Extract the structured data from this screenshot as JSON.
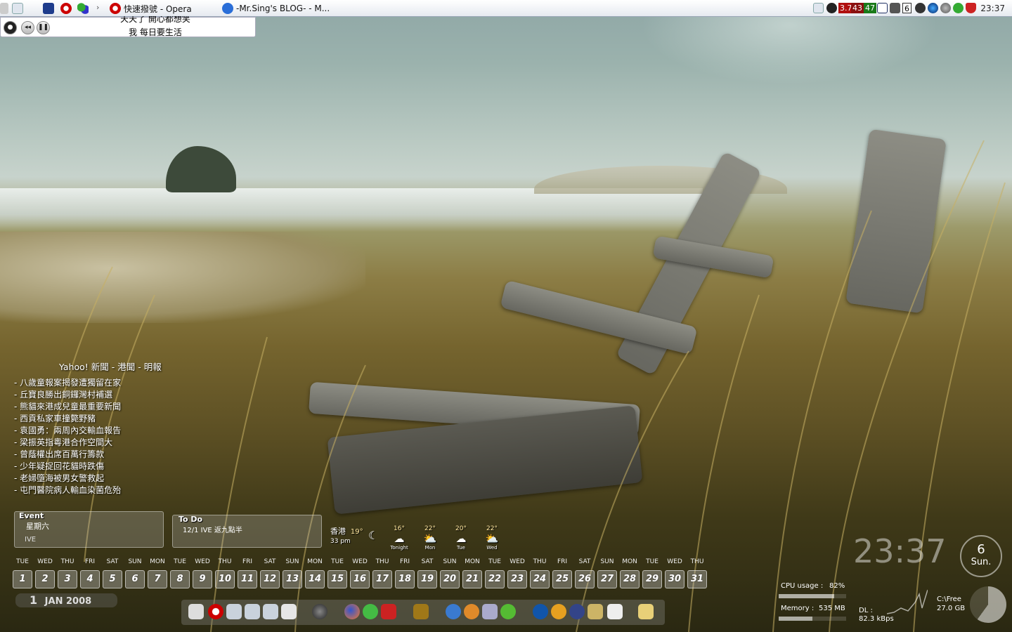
{
  "taskbar": {
    "buttons": [
      {
        "label": "快速撥號 - Opera"
      },
      {
        "label": "-Mr.Sing's BLOG- - M..."
      }
    ],
    "tray_badges": [
      {
        "value": "3.7",
        "color": "#b01010"
      },
      {
        "value": "43",
        "color": "#8a1010"
      },
      {
        "value": "47",
        "color": "#1a7a1a"
      },
      {
        "value": "6",
        "color": "#ffffff"
      }
    ],
    "clock": "23:37"
  },
  "lyrics": {
    "line1": "天天了 開心都想笑",
    "line2": "我 每日要生活"
  },
  "news": {
    "title": "Yahoo! 新聞 - 港聞 - 明報",
    "items": [
      "八歲童報案揭發遭獨留在家",
      "丘寶良勝出銅鑼灣村補選",
      "熊貓來港成兒童最重要新聞",
      "西貢私家車撞斃野豬",
      "袁國勇：兩周內交輸血報告",
      "梁振英指粵港合作空間大",
      "曾蔭權出席百萬行籌款",
      "少年疑捉回花貓時跌傷",
      "老婦墮海被男女警救起",
      "屯門醫院病人輸血染菌危殆"
    ]
  },
  "event": {
    "header": "Event",
    "day": "星期六",
    "item": "IVE"
  },
  "todo": {
    "header": "To Do",
    "item": "12/1  IVE 返九點半"
  },
  "calendar": {
    "days": [
      "TUE",
      "WED",
      "THU",
      "FRI",
      "SAT",
      "SUN",
      "MON",
      "TUE",
      "WED",
      "THU",
      "FRI",
      "SAT",
      "SUN",
      "MON",
      "TUE",
      "WED",
      "THU",
      "FRI",
      "SAT",
      "SUN",
      "MON",
      "TUE",
      "WED",
      "THU",
      "FRI",
      "SAT",
      "SUN",
      "MON",
      "TUE",
      "WED",
      "THU"
    ],
    "dates": [
      "1",
      "2",
      "3",
      "4",
      "5",
      "6",
      "7",
      "8",
      "9",
      "10",
      "11",
      "12",
      "13",
      "14",
      "15",
      "16",
      "17",
      "18",
      "19",
      "20",
      "21",
      "22",
      "23",
      "24",
      "25",
      "26",
      "27",
      "28",
      "29",
      "30",
      "31"
    ],
    "footer_day": "1",
    "footer_month": "JAN 2008"
  },
  "weather": {
    "city": "香港",
    "time": "33 pm",
    "now": "19°",
    "forecast": [
      {
        "temp": "16°",
        "label": "Tonight"
      },
      {
        "temp": "22°",
        "label": "Mon"
      },
      {
        "temp": "20°",
        "label": "Tue"
      },
      {
        "temp": "22°",
        "label": "Wed"
      }
    ]
  },
  "dock": {
    "icons": [
      "notes-icon",
      "opera-icon",
      "folder-icon",
      "folder-icon",
      "folder-icon",
      "recycle-bin-icon",
      "media-player-icon",
      "firefox-icon",
      "green-app-icon",
      "acrobat-icon",
      "rss-icon",
      "messenger-icon",
      "orange-app-icon",
      "edit-icon",
      "green-leaf-icon",
      "vu-icon",
      "info-icon",
      "blue-app-icon",
      "send-icon",
      "document-icon",
      "sticky-note-icon"
    ]
  },
  "desk_clock": {
    "time": "23:37",
    "day_num": "6",
    "day_name": "Sun."
  },
  "sysmon": {
    "cpu_label": "CPU usage :",
    "cpu_value": "82%",
    "cpu_level": 0.82,
    "mem_label": "Memory :",
    "mem_value": "535 MB",
    "mem_level": 0.5,
    "dl_label": "DL :",
    "dl_value": "82.3 kBps",
    "drive_label": "C:\\Free",
    "drive_value": "27.0 GB"
  }
}
